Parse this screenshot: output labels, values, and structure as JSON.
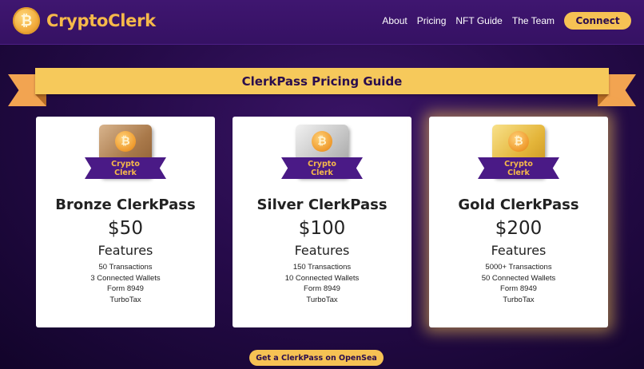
{
  "header": {
    "logo_text": "CryptoClerk",
    "logo_glyph": "₿",
    "nav": [
      "About",
      "Pricing",
      "NFT Guide",
      "The Team"
    ],
    "connect_label": "Connect"
  },
  "banner": {
    "title": "ClerkPass Pricing Guide"
  },
  "badge": {
    "line1": "Crypto",
    "line2": "Clerk",
    "glyph": "₿"
  },
  "cards": [
    {
      "tier": "bronze",
      "title": "Bronze ClerkPass",
      "price": "$50",
      "features_heading": "Features",
      "features": [
        "50 Transactions",
        "3 Connected Wallets",
        "Form 8949",
        "TurboTax"
      ]
    },
    {
      "tier": "silver",
      "title": "Silver ClerkPass",
      "price": "$100",
      "features_heading": "Features",
      "features": [
        "150 Transactions",
        "10 Connected Wallets",
        "Form 8949",
        "TurboTax"
      ]
    },
    {
      "tier": "gold",
      "title": "Gold ClerkPass",
      "price": "$200",
      "features_heading": "Features",
      "features": [
        "5000+ Transactions",
        "50 Connected Wallets",
        "Form 8949",
        "TurboTax"
      ]
    }
  ],
  "cta": {
    "label": "Get a ClerkPass on OpenSea"
  },
  "colors": {
    "accent": "#f6c254",
    "brand_purple": "#3f1670",
    "ribbon": "#f6c95b"
  }
}
